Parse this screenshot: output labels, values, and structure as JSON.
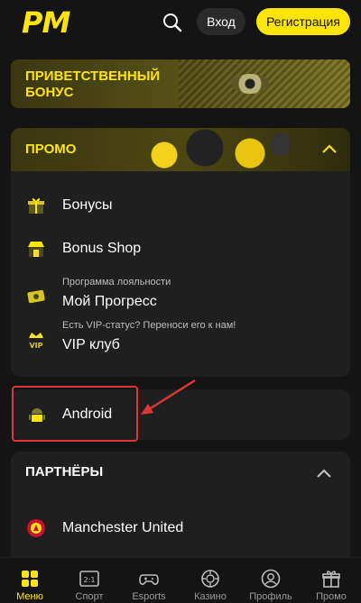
{
  "header": {
    "logo": "PM",
    "login_label": "Вход",
    "register_label": "Регистрация"
  },
  "bonus_banner": {
    "title": "ПРИВЕТСТВЕННЫЙ БОНУС"
  },
  "promo": {
    "title": "ПРОМО",
    "items": [
      {
        "label": "Бонусы",
        "subtitle": "",
        "icon": "gift-icon"
      },
      {
        "label": "Bonus Shop",
        "subtitle": "",
        "icon": "shop-icon"
      },
      {
        "label": "Мой Прогресс",
        "subtitle": "Программа лояльности",
        "icon": "ticket-icon"
      },
      {
        "label": "VIP клуб",
        "subtitle": "Есть VIP-статус? Переноси его к нам!",
        "icon": "vip-icon"
      }
    ]
  },
  "android": {
    "label": "Android",
    "icon": "android-icon"
  },
  "partners": {
    "title": "ПАРТНЁРЫ",
    "items": [
      {
        "label": "Manchester United",
        "icon": "manchester-united-crest-icon"
      }
    ]
  },
  "bottom_nav": [
    {
      "label": "Меню",
      "icon": "menu-grid-icon",
      "active": true
    },
    {
      "label": "Спорт",
      "icon": "scoreboard-icon",
      "active": false
    },
    {
      "label": "Esports",
      "icon": "gamepad-icon",
      "active": false
    },
    {
      "label": "Казино",
      "icon": "casino-chip-icon",
      "active": false
    },
    {
      "label": "Профиль",
      "icon": "profile-icon",
      "active": false
    },
    {
      "label": "Промо",
      "icon": "gift-icon",
      "active": false
    }
  ],
  "colors": {
    "accent": "#ffe600",
    "background": "#141414",
    "card": "#1f1f1f",
    "highlight": "#e03535"
  }
}
